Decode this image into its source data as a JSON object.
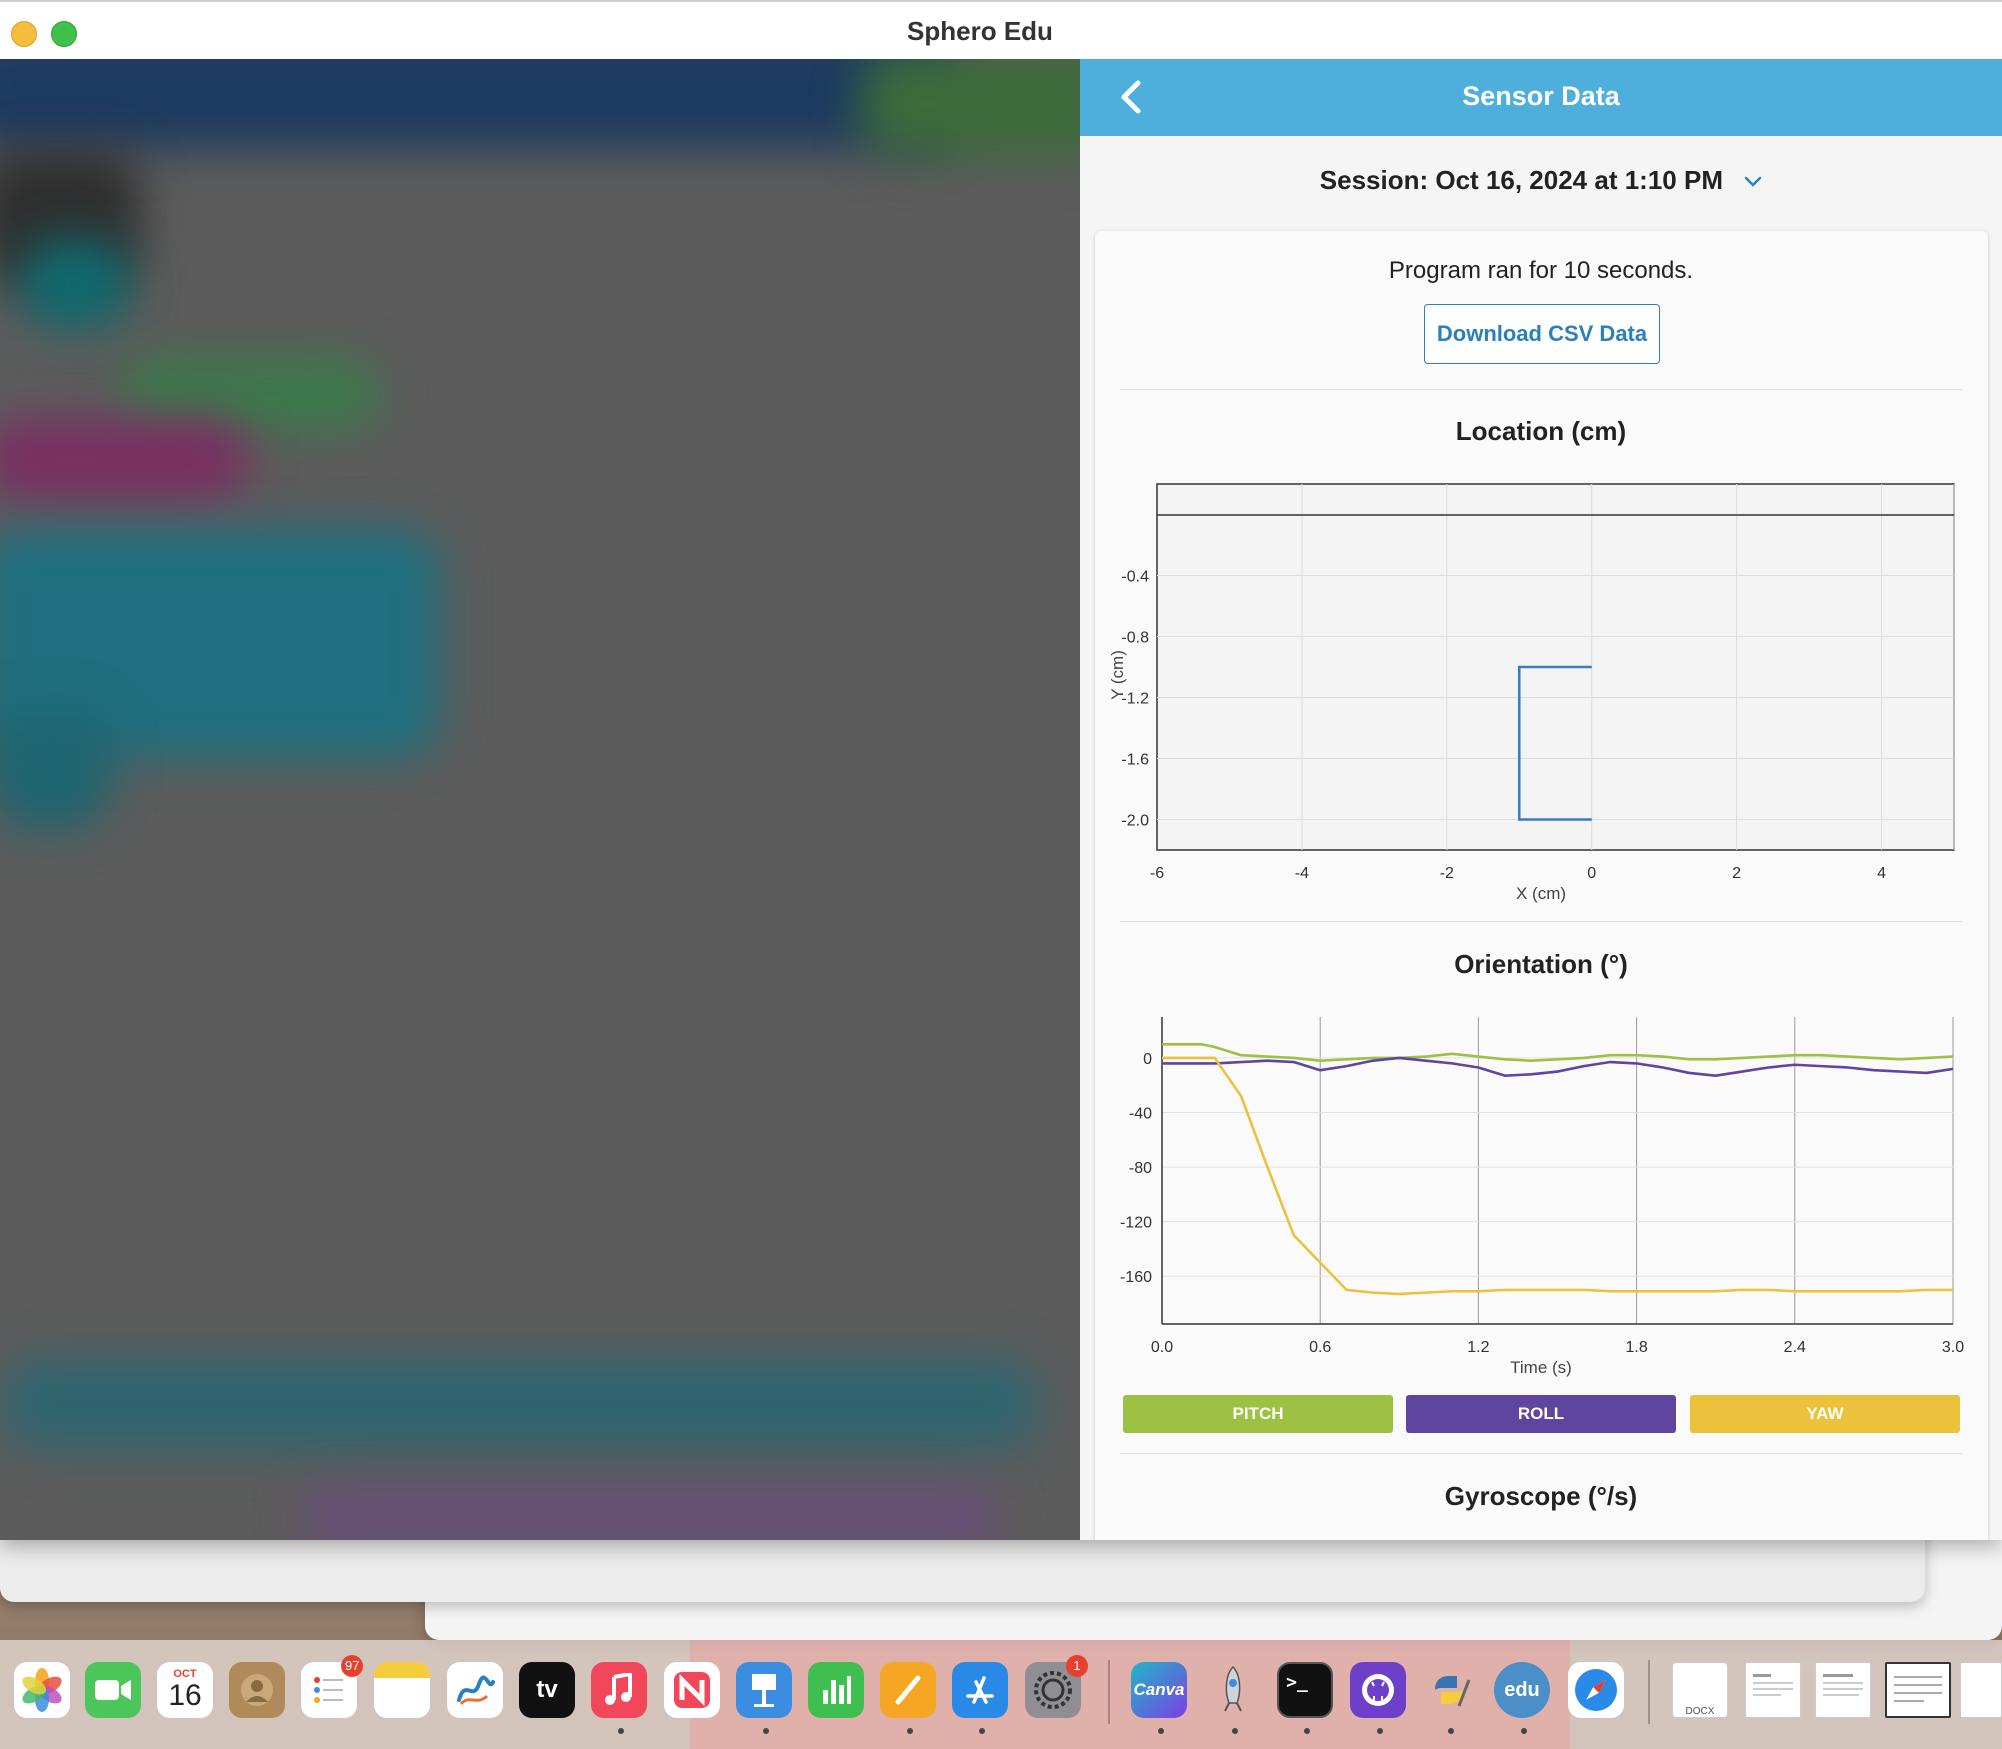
{
  "window": {
    "title": "Sphero Edu"
  },
  "panel": {
    "title": "Sensor Data",
    "session": "Session: Oct 16, 2024 at 1:10 PM",
    "run_text": "Program ran for 10 seconds.",
    "download_label": "Download CSV Data"
  },
  "colors": {
    "header": "#4eaedc",
    "pitch": "#9dc143",
    "roll": "#5f45a0",
    "yaw": "#ecc13b",
    "location": "#3b7bbf"
  },
  "location_chart": {
    "title": "Location (cm)",
    "xlabel": "X (cm)",
    "ylabel": "Y (cm)",
    "xticks": [
      "-6",
      "-4",
      "-2",
      "0",
      "2",
      "4"
    ],
    "yticks": [
      "-0.4",
      "-0.8",
      "-1.2",
      "-1.6",
      "-2.0"
    ]
  },
  "orientation_chart": {
    "title": "Orientation (°)",
    "xlabel": "Time (s)",
    "xticks": [
      "0.0",
      "0.6",
      "1.2",
      "1.8",
      "2.4",
      "3.0"
    ],
    "yticks": [
      "0",
      "-40",
      "-80",
      "-120",
      "-160"
    ]
  },
  "legend": {
    "pitch": "PITCH",
    "roll": "ROLL",
    "yaw": "YAW"
  },
  "gyroscope": {
    "title": "Gyroscope (°/s)"
  },
  "dock": {
    "calendar_month": "OCT",
    "calendar_day": "16",
    "reminders_badge": "97",
    "settings_badge": "1",
    "canva_label": "Canva",
    "edu_label": "edu",
    "docx_label": "DOCX",
    "appletv_label": "tv"
  },
  "chart_data": [
    {
      "type": "line",
      "title": "Location (cm)",
      "xlabel": "X (cm)",
      "ylabel": "Y (cm)",
      "xlim": [
        -6,
        5
      ],
      "ylim": [
        -2.2,
        0.2
      ],
      "series": [
        {
          "x": [
            0,
            -1,
            -1,
            0
          ],
          "y": [
            -1.0,
            -1.0,
            -2.0,
            -2.0
          ]
        }
      ]
    },
    {
      "type": "line",
      "title": "Orientation (°)",
      "xlabel": "Time (s)",
      "ylabel": "",
      "xlim": [
        0,
        3.0
      ],
      "ylim": [
        -195,
        30
      ],
      "x": [
        0.0,
        0.1,
        0.15,
        0.2,
        0.3,
        0.4,
        0.5,
        0.6,
        0.7,
        0.8,
        0.9,
        1.0,
        1.1,
        1.2,
        1.3,
        1.4,
        1.5,
        1.6,
        1.7,
        1.8,
        1.9,
        2.0,
        2.1,
        2.2,
        2.3,
        2.4,
        2.5,
        2.6,
        2.7,
        2.8,
        2.9,
        3.0
      ],
      "series": [
        {
          "name": "PITCH",
          "values": [
            10,
            10,
            10,
            8,
            2,
            1,
            0,
            -2,
            -1,
            0,
            0,
            1,
            3,
            1,
            -1,
            -2,
            -1,
            0,
            2,
            2,
            1,
            -1,
            -1,
            0,
            1,
            2,
            2,
            1,
            0,
            -1,
            0,
            1
          ]
        },
        {
          "name": "ROLL",
          "values": [
            -4,
            -4,
            -4,
            -4,
            -3,
            -2,
            -3,
            -9,
            -6,
            -2,
            0,
            -2,
            -4,
            -7,
            -13,
            -12,
            -10,
            -6,
            -3,
            -4,
            -7,
            -11,
            -13,
            -10,
            -7,
            -5,
            -6,
            -7,
            -9,
            -10,
            -11,
            -8
          ]
        },
        {
          "name": "YAW",
          "values": [
            0,
            0,
            0,
            0,
            -28,
            -80,
            -130,
            -150,
            -170,
            -172,
            -173,
            -172,
            -171,
            -171,
            -170,
            -170,
            -170,
            -170,
            -171,
            -171,
            -171,
            -171,
            -171,
            -170,
            -170,
            -171,
            -171,
            -171,
            -171,
            -171,
            -170,
            -170
          ]
        }
      ]
    }
  ]
}
